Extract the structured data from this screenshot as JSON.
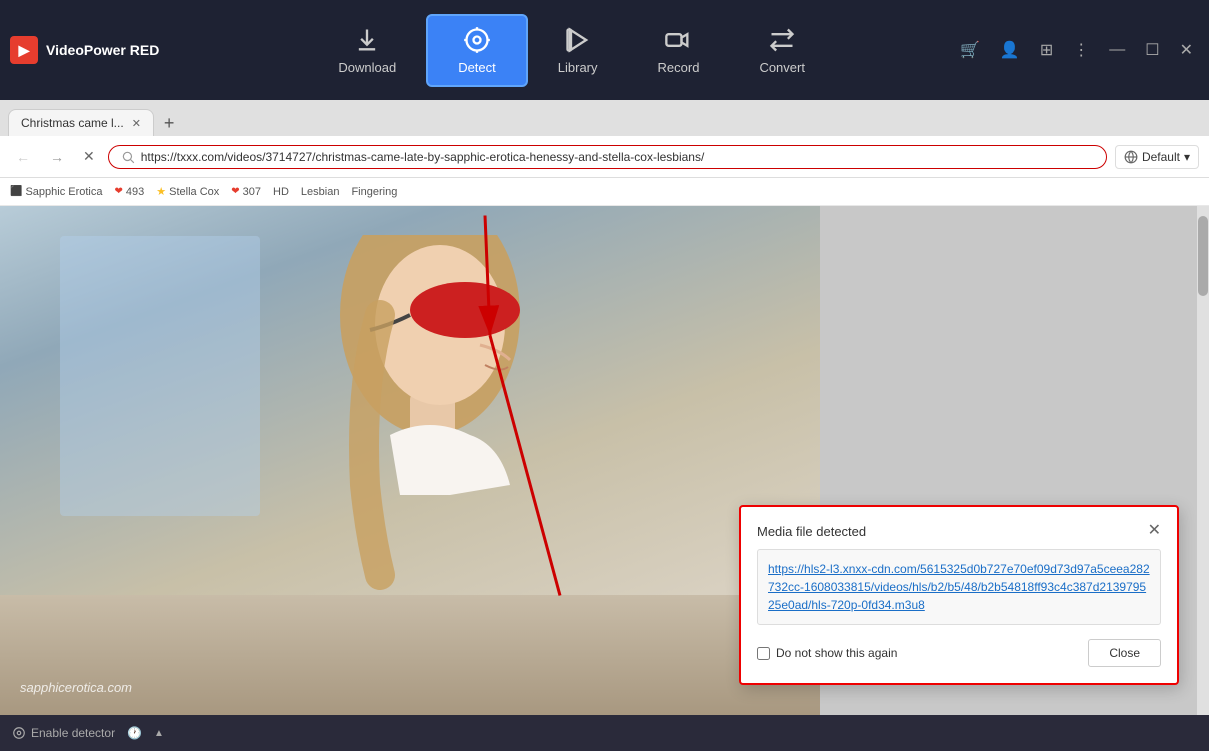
{
  "app": {
    "name": "VideoPower RED"
  },
  "titlebar": {
    "controls": {
      "cart": "🛒",
      "user": "👤",
      "grid": "⊞",
      "more": "⋮",
      "minimize": "—",
      "maximize": "☐",
      "close": "✕"
    }
  },
  "nav": {
    "items": [
      {
        "id": "download",
        "label": "Download",
        "active": false
      },
      {
        "id": "detect",
        "label": "Detect",
        "active": true
      },
      {
        "id": "library",
        "label": "Library",
        "active": false
      },
      {
        "id": "record",
        "label": "Record",
        "active": false
      },
      {
        "id": "convert",
        "label": "Convert",
        "active": false
      }
    ]
  },
  "browser": {
    "tab": {
      "title": "Christmas came l...",
      "url": "https://txxx.com/videos/3714727/christmas-came-late-by-sapphic-erotica-henessy-and-stella-cox-lesbians/"
    },
    "tags": [
      {
        "type": "icon",
        "label": "Sapphic Erotica"
      },
      {
        "type": "count",
        "label": "493"
      },
      {
        "type": "icon",
        "label": "Stella Cox"
      },
      {
        "type": "count",
        "label": "307"
      },
      {
        "type": "tag",
        "label": "HD"
      },
      {
        "type": "tag",
        "label": "Lesbian"
      },
      {
        "type": "tag",
        "label": "Fingering"
      }
    ],
    "default_label": "Default"
  },
  "media_dialog": {
    "title": "Media file detected",
    "url": "https://hls2-l3.xnxx-cdn.com/5615325d0b727e70ef09d73d97a5ceea282732cc-1608033815/videos/hls/b2/b5/48/b2b54818ff93c4c387d213979525e0ad/hls-720p-0fd34.m3u8",
    "checkbox_label": "Do not show this again",
    "close_button": "Close"
  },
  "bottom_bar": {
    "detector_label": "Enable detector",
    "history_icon": "🕐"
  },
  "watermark": "sapphicerotica.com"
}
